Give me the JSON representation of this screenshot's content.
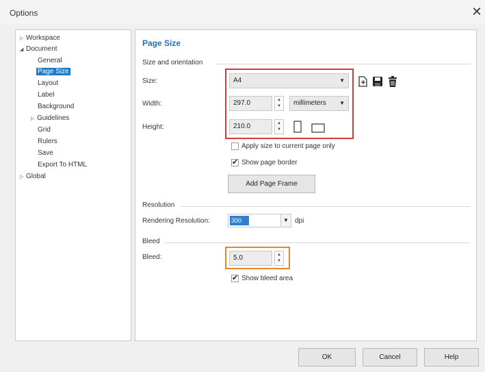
{
  "window": {
    "title": "Options",
    "close_glyph": "✕"
  },
  "tree": [
    {
      "label": "Workspace",
      "arrow": "▷"
    },
    {
      "label": "Document",
      "arrow": "◢"
    },
    {
      "label": "General",
      "arrow": ""
    },
    {
      "label": "Page Size",
      "arrow": "",
      "selected": true
    },
    {
      "label": "Layout",
      "arrow": ""
    },
    {
      "label": "Label",
      "arrow": ""
    },
    {
      "label": "Background",
      "arrow": ""
    },
    {
      "label": "Guidelines",
      "arrow": "▷"
    },
    {
      "label": "Grid",
      "arrow": ""
    },
    {
      "label": "Rulers",
      "arrow": ""
    },
    {
      "label": "Save",
      "arrow": ""
    },
    {
      "label": "Export To HTML",
      "arrow": ""
    },
    {
      "label": "Global",
      "arrow": "▷"
    }
  ],
  "page": {
    "heading": "Page Size",
    "size_orientation": {
      "group_label": "Size and orientation",
      "size_label": "Size:",
      "size_value": "A4",
      "width_label": "Width:",
      "width_value": "297.0",
      "units_value": "millimeters",
      "height_label": "Height:",
      "height_value": "210.0",
      "apply_current_page_label": "Apply size to current page only",
      "apply_current_page_checked": false,
      "show_page_border_label": "Show page border",
      "show_page_border_checked": true,
      "add_page_frame_label": "Add Page Frame"
    },
    "resolution": {
      "group_label": "Resolution",
      "rendering_label": "Rendering Resolution:",
      "rendering_value": "300",
      "unit": "dpi"
    },
    "bleed": {
      "group_label": "Bleed",
      "bleed_label": "Bleed:",
      "bleed_value": "5.0",
      "show_bleed_label": "Show bleed area",
      "show_bleed_checked": true
    }
  },
  "buttons": {
    "ok": "OK",
    "cancel": "Cancel",
    "help": "Help"
  },
  "colors": {
    "accent": "#1979ca",
    "heading": "#1f6fbf",
    "highlight_red": "#d83a3a",
    "highlight_orange": "#e5862b"
  }
}
